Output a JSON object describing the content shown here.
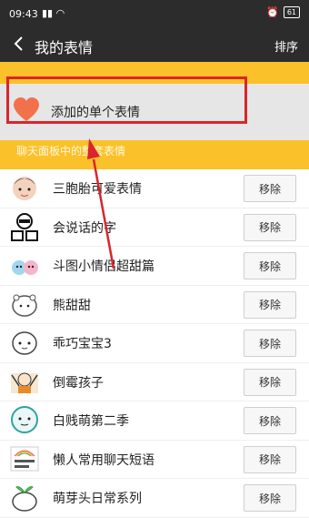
{
  "status": {
    "time": "09:43",
    "battery": "61"
  },
  "header": {
    "title": "我的表情",
    "sort_label": "排序"
  },
  "single": {
    "label": "添加的单个表情"
  },
  "section": {
    "label": "聊天面板中的整套表情"
  },
  "sets": [
    {
      "name": "三胞胎可爱表情",
      "remove": "移除",
      "icon": "baby-face-icon"
    },
    {
      "name": "会说话的字",
      "remove": "移除",
      "icon": "talking-text-icon"
    },
    {
      "name": "斗图小情侣超甜篇",
      "remove": "移除",
      "icon": "couple-icon"
    },
    {
      "name": "熊甜甜",
      "remove": "移除",
      "icon": "bear-icon"
    },
    {
      "name": "乖巧宝宝3",
      "remove": "移除",
      "icon": "baby-icon"
    },
    {
      "name": "倒霉孩子",
      "remove": "移除",
      "icon": "kid-icon"
    },
    {
      "name": "白贱萌第二季",
      "remove": "移除",
      "icon": "round-face-icon"
    },
    {
      "name": "懒人常用聊天短语",
      "remove": "移除",
      "icon": "daily-phrase-icon"
    },
    {
      "name": "萌芽头日常系列",
      "remove": "移除",
      "icon": "sprout-head-icon"
    }
  ]
}
